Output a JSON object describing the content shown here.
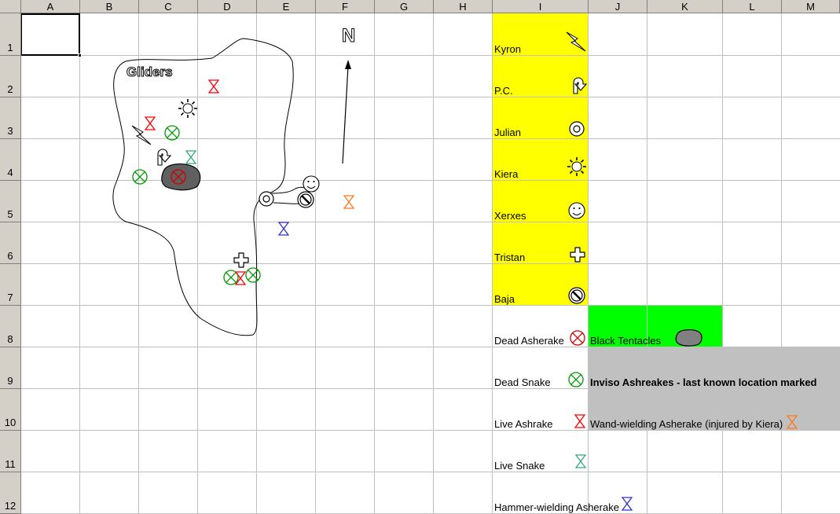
{
  "columns": [
    "A",
    "B",
    "C",
    "D",
    "E",
    "F",
    "G",
    "H",
    "I",
    "J",
    "K",
    "L",
    "M"
  ],
  "rows": [
    "1",
    "2",
    "3",
    "4",
    "5",
    "6",
    "7",
    "8",
    "9",
    "10",
    "11",
    "12"
  ],
  "map": {
    "region_label": "Gliders",
    "north_label": "N"
  },
  "legend": {
    "characters": [
      {
        "name": "Kyron",
        "icon": "lightning-bolt-icon"
      },
      {
        "name": "P.C.",
        "icon": "u-turn-arrow-icon"
      },
      {
        "name": "Julian",
        "icon": "target-circle-icon"
      },
      {
        "name": "Kiera",
        "icon": "sun-icon"
      },
      {
        "name": "Xerxes",
        "icon": "smiley-face-icon"
      },
      {
        "name": "Tristan",
        "icon": "cross-icon"
      },
      {
        "name": "Baja",
        "icon": "no-symbol-icon"
      }
    ],
    "markers": [
      {
        "name": "Dead Asherake",
        "icon": "red-x-circle-icon"
      },
      {
        "name": "Dead Snake",
        "icon": "green-x-circle-icon"
      },
      {
        "name": "Live Ashrake",
        "icon": "red-hourglass-icon"
      },
      {
        "name": "Live Snake",
        "icon": "teal-hourglass-icon"
      },
      {
        "name": "Hammer-wielding Asherake",
        "icon": "blue-hourglass-icon"
      }
    ],
    "black_tentacles": "Black Tentacles",
    "inviso": "Inviso Ashreakes - last known location marked",
    "wand": "Wand-wielding Asherake (injured by Kiera)"
  },
  "colors": {
    "yellow_fill": "#ffff00",
    "green_fill": "#00ff00",
    "gray_fill": "#c0c0c0",
    "dead_red": "#d00000",
    "dead_green": "#009900",
    "live_red": "#ff0000",
    "live_teal": "#33aa77",
    "hammer_blue": "#3333cc",
    "wand_orange": "#ff7722"
  }
}
